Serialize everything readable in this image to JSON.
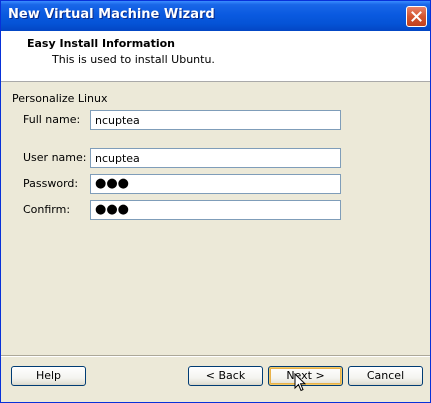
{
  "window": {
    "title": "New Virtual Machine Wizard",
    "close_icon": "close-icon"
  },
  "header": {
    "title": "Easy Install Information",
    "subtitle": "This is used to install Ubuntu."
  },
  "form": {
    "section_label": "Personalize Linux",
    "full_name": {
      "label": "Full name:",
      "value": "ncuptea"
    },
    "user_name": {
      "label": "User name:",
      "value": "ncuptea"
    },
    "password": {
      "label": "Password:",
      "masked_value": "●●●"
    },
    "confirm": {
      "label": "Confirm:",
      "masked_value": "●●●"
    }
  },
  "footer": {
    "help_label": "Help",
    "back_label": "< Back",
    "next_label": "Next >",
    "cancel_label": "Cancel"
  },
  "colors": {
    "titlebar": "#0553d6",
    "dialog_bg": "#ece9d8",
    "field_border": "#7f9db9",
    "button_border": "#003c74"
  }
}
